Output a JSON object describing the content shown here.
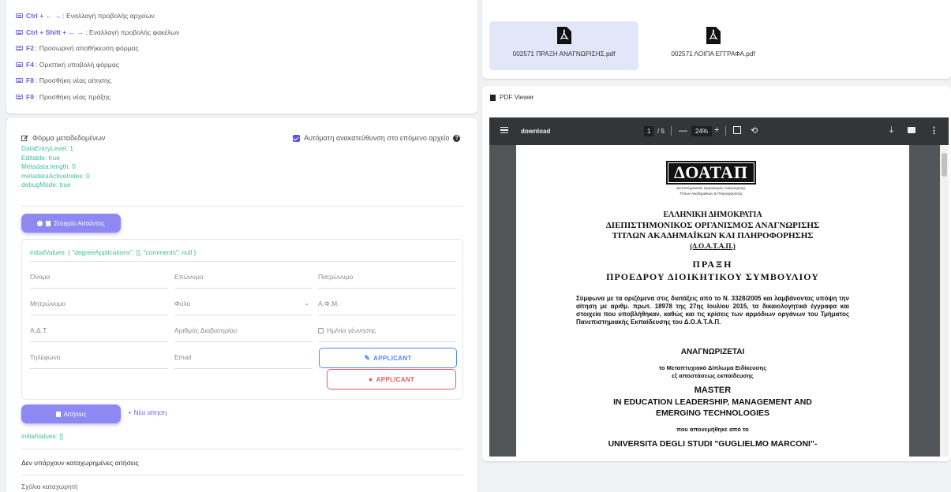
{
  "shortcuts": [
    {
      "key": "Ctrl + ← →",
      "text": ": Εναλλαγή προβολής αρχείων"
    },
    {
      "key": "Ctrl + Shift + ← →",
      "text": ": Εναλλαγή προβολής φακέλων"
    },
    {
      "key": "F2",
      "text": ": Προσωρινή αποθήκευση φόρμας"
    },
    {
      "key": "F4",
      "text": ": Οριστική υποβολή φόρμας"
    },
    {
      "key": "F8",
      "text": ": Προσθήκη νέας αίτησης"
    },
    {
      "key": "F9",
      "text": ": Προσθήκη νέας πράξης"
    }
  ],
  "form": {
    "title": "Φόρμα μεταδεδομένων",
    "auto_redirect_label": "Αυτόματη ανακατεύθυνση στο επόμενο αρχείο",
    "auto_redirect_checked": true,
    "debug_lines": [
      "DataEntryLevel: 1",
      "Editable: true",
      "Metadata.length: 0",
      "metadataActiveIndex: 0",
      "debugMode: true"
    ],
    "applicant_section_button": "Στοιχεία Αιτούντος",
    "initial_values": "initialValues: { \"degreeApplications\": [], \"comments\": null }",
    "fields": {
      "first_name": "Όνομα",
      "last_name": "Επώνυμο",
      "father_name": "Πατρώνυμο",
      "mother_name": "Μητρώνυμο",
      "gender": "Φύλο",
      "afm": "Α.Φ.Μ.",
      "adt": "Α.Δ.Τ.",
      "passport": "Αριθμός Διαβατηρίου",
      "birth_date": "Ημ/νία γέννησης",
      "phone": "Τηλέφωνο",
      "email": "Email"
    },
    "edit_applicant_button": "APPLICANT",
    "delete_applicant_button": "APPLICANT",
    "applications_button": "Αιτήσεις",
    "new_application_link": "+ Νέα αίτηση",
    "applications_initial_values": "initialValues: []",
    "no_applications_text": "Δεν υπάρχουν καταχωρημένες αιτήσεις",
    "comments_label": "Σχόλια καταχωρητή"
  },
  "attachments": [
    {
      "name": "002571 ΠΡΑΞΗ ΑΝΑΓΝΩΡΙΣΗΣ.pdf",
      "active": true
    },
    {
      "name": "002571 ΛΟΙΠΑ ΕΓΓΡΑΦΑ.pdf",
      "active": false
    }
  ],
  "viewer": {
    "title": "PDF Viewer",
    "toolbar": {
      "filename": "download",
      "page_current": "1",
      "page_total": "/ 5",
      "zoom": "24%"
    },
    "document": {
      "logo": "ΔΟΑΤΑΠ",
      "logo_sub_1": "Διεπιστημονικός Οργανισμός Αναγνώρισης",
      "logo_sub_2": "Τίτλων Ακαδημαϊκών & Πληροφόρησης",
      "line1": "ΕΛΛΗΝΙΚΗ ΔΗΜΟΚΡΑΤΙΑ",
      "line2": "ΔΙΕΠΙΣΤΗΜΟΝΙΚΟΣ ΟΡΓΑΝΙΣΜΟΣ ΑΝΑΓΝΩΡΙΣΗΣ",
      "line3": "ΤΙΤΛΩΝ ΑΚΑΔΗΜΑΪΚΩΝ ΚΑΙ ΠΛΗΡΟΦΟΡΗΣΗΣ",
      "line4": "(Δ.Ο.Α.Τ.Α.Π.)",
      "act_title": "ΠΡΑΞΗ",
      "act_subtitle": "ΠΡΟΕΔΡΟΥ ΔΙΟΙΚΗΤΙΚΟΥ ΣΥΜΒΟΥΛΙΟΥ",
      "paragraph": "Σύμφωνα με τα οριζόμενα στις διατάξεις από το Ν. 3328/2005 και λαμβάνοντας υπόψη την αίτηση με αριθμ. πρωτ. 18978 της 27ης Ιουλίου 2015, τα δικαιολογητικά έγγραφα και στοιχεία που υποβλήθηκαν, καθώς και τις κρίσεις των αρμόδιων οργάνων του Τμήματος Πανεπιστημιακής Εκπαίδευσης του Δ.Ο.Α.Τ.Α.Π.",
      "recognized": "ΑΝΑΓΝΩΡΙΖΕΤΑΙ",
      "degree_line1": "το Μεταπτυχιακό Δίπλωμα Ειδίκευσης",
      "degree_line2": "εξ αποστάσεως εκπαίδευσης",
      "master": "MASTER",
      "program1": "IN EDUCATION LEADERSHIP, MANAGEMENT AND",
      "program2": "EMERGING TECHNOLOGIES",
      "awarded_by": "που απονεμήθηκε από το",
      "university": "UNIVERSITA DEGLI STUDI \"GUGLIELMO MARCONI\"-"
    }
  },
  "colors": {
    "accent": "#6f5fe0",
    "debug_green": "#3fbf9a",
    "blue_btn": "#4d87ee",
    "red_btn": "#ee5a5a"
  }
}
